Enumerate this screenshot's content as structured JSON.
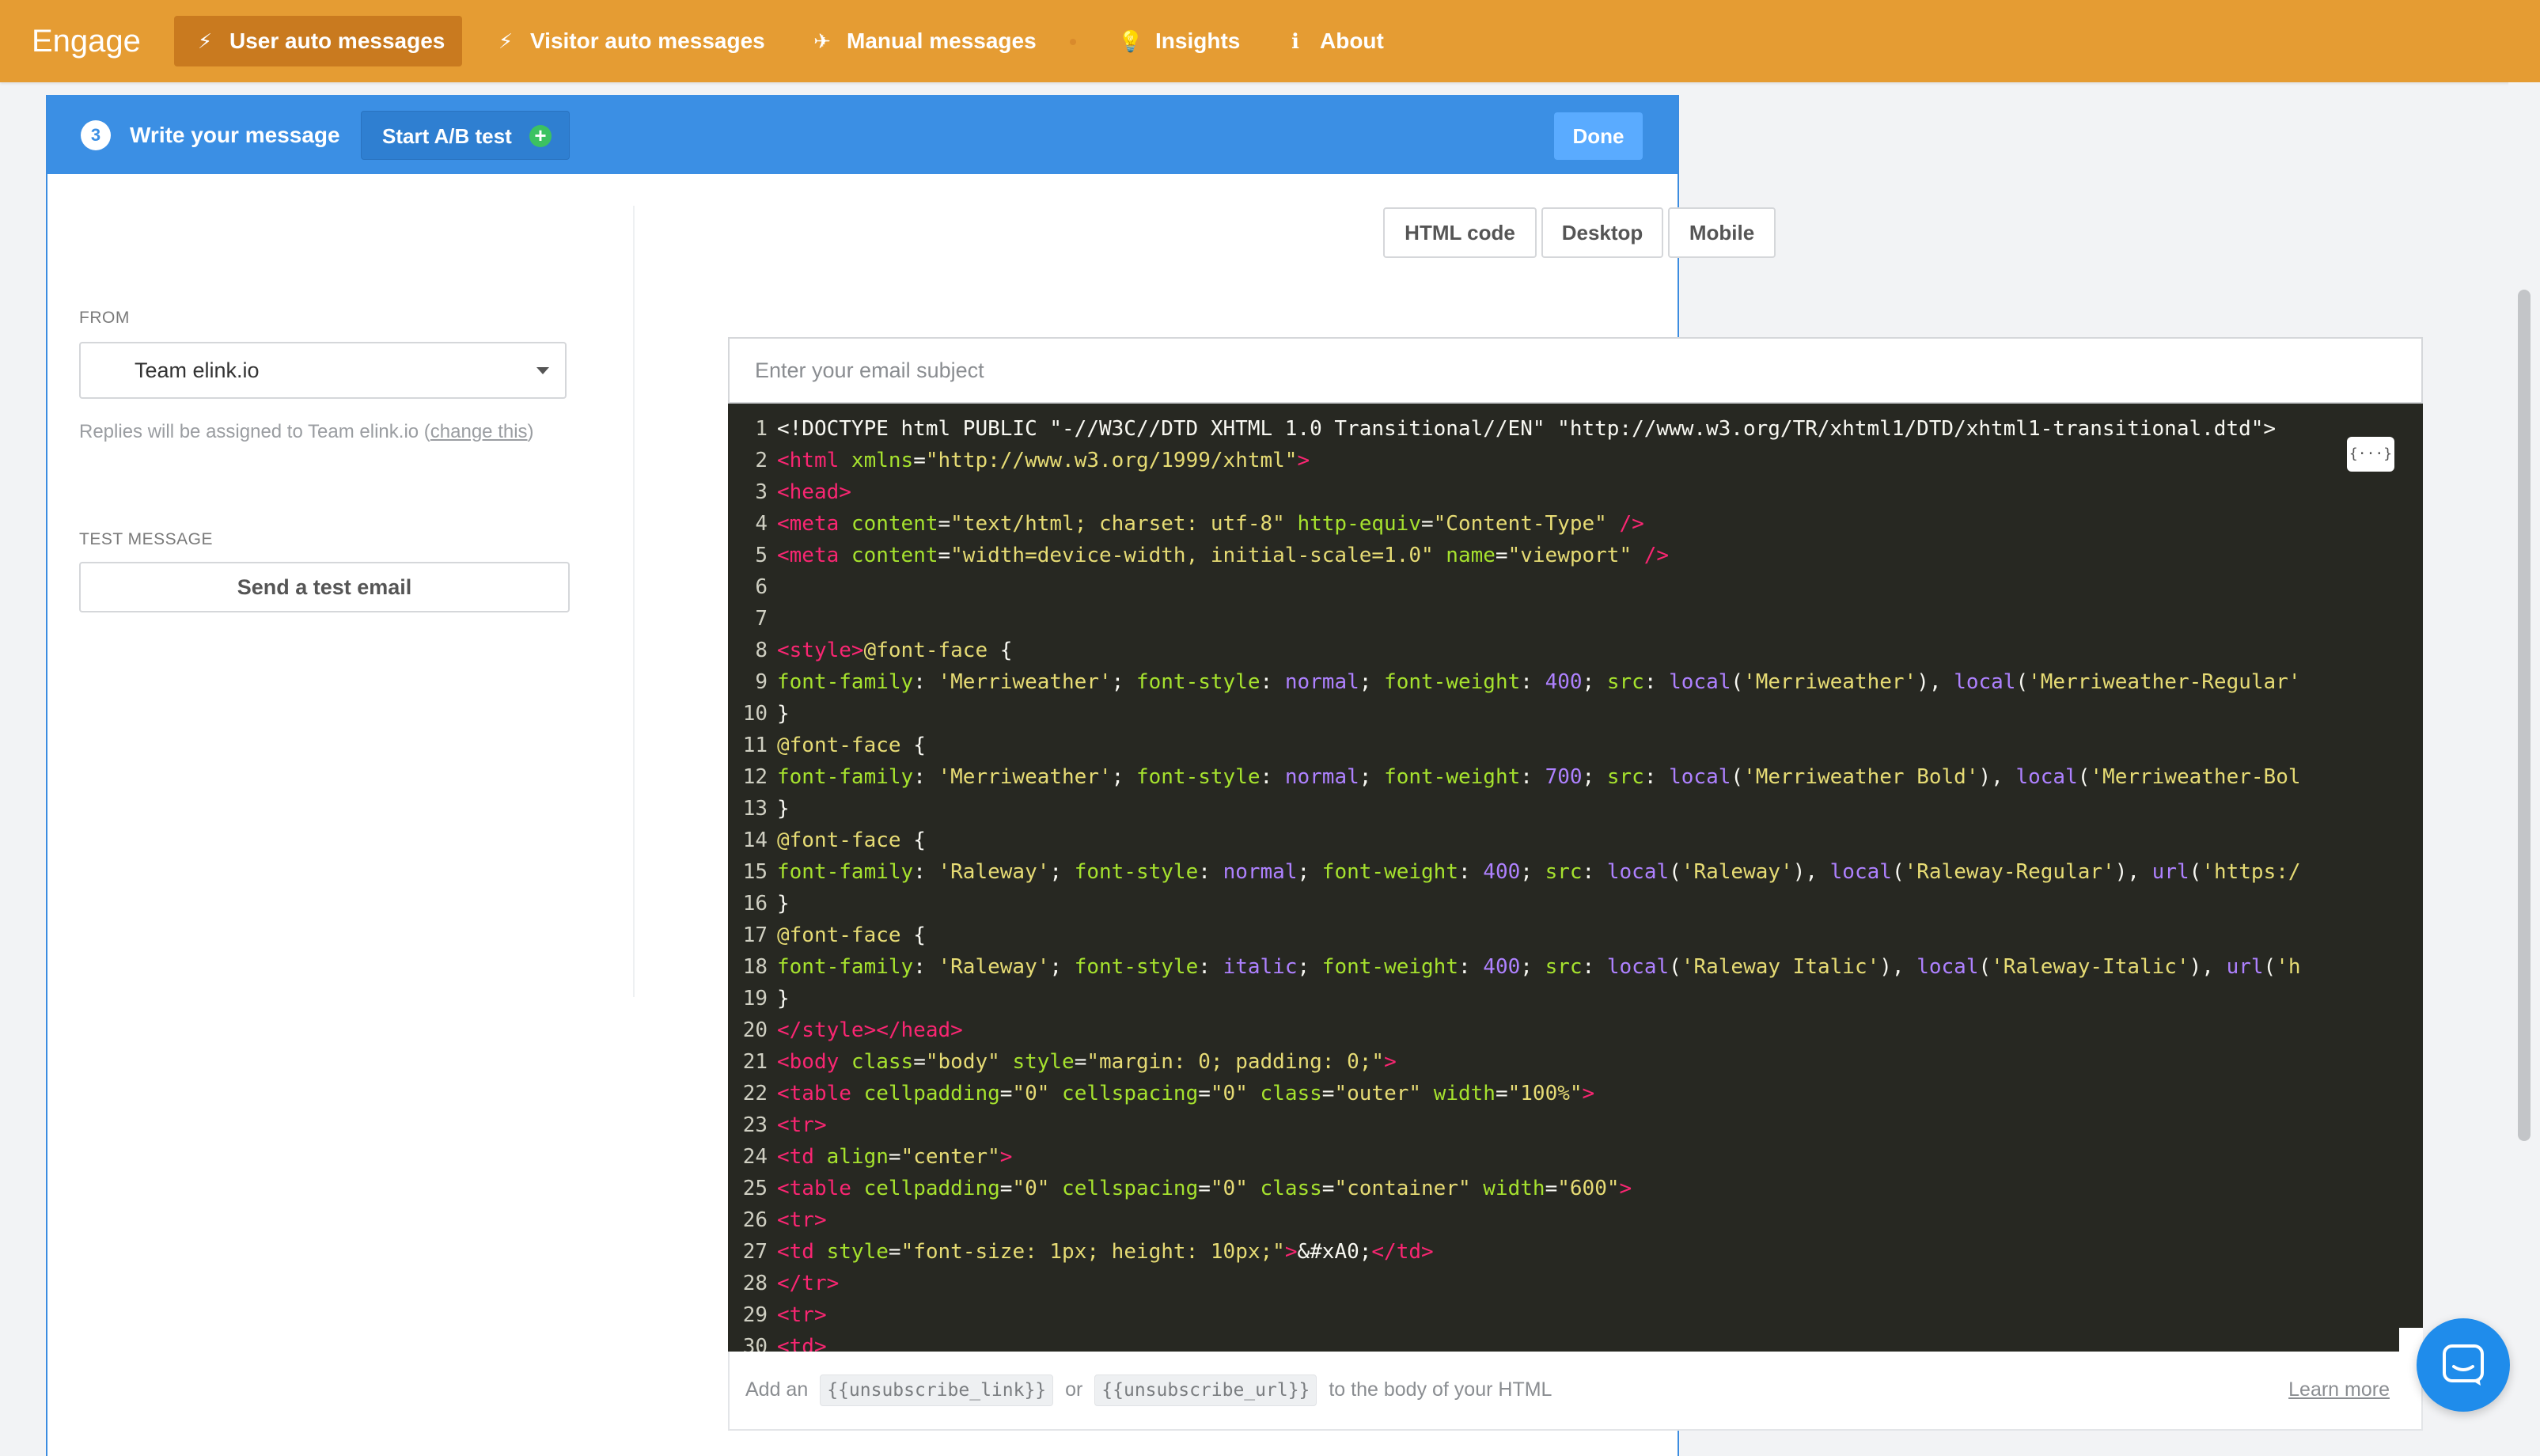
{
  "nav": {
    "brand": "Engage",
    "items": [
      {
        "label": "User auto messages",
        "icon": "bolt-icon",
        "glyph": "⚡",
        "active": true
      },
      {
        "label": "Visitor auto messages",
        "icon": "bolt-icon",
        "glyph": "⚡",
        "active": false
      },
      {
        "label": "Manual messages",
        "icon": "paper-plane-icon",
        "glyph": "✈",
        "active": false
      },
      {
        "label": "Insights",
        "icon": "lightbulb-icon",
        "glyph": "💡",
        "active": false
      },
      {
        "label": "About",
        "icon": "info-icon",
        "glyph": "ℹ",
        "active": false
      }
    ]
  },
  "header": {
    "step_number": "3",
    "title": "Write your message",
    "ab_button": "Start A/B test",
    "done_button": "Done"
  },
  "left": {
    "from_label": "FROM",
    "from_value": "Team elink.io",
    "replies_note_prefix": "Replies will be assigned to Team elink.io (",
    "replies_note_link": "change this",
    "replies_note_suffix": ")",
    "test_label": "TEST MESSAGE",
    "test_button": "Send a test email"
  },
  "view_tabs": [
    "HTML code",
    "Desktop",
    "Mobile"
  ],
  "subject": {
    "placeholder": "Enter your email subject",
    "value": ""
  },
  "code_lines": [
    [
      [
        "plain",
        "<!DOCTYPE html PUBLIC \"-//W3C//DTD XHTML 1.0 Transitional//EN\" \"http://www.w3.org/TR/xhtml1/DTD/xhtml1-transitional.dtd\">"
      ]
    ],
    [
      [
        "tag",
        "<html "
      ],
      [
        "attr",
        "xmlns"
      ],
      [
        "plain",
        "="
      ],
      [
        "str",
        "\"http://www.w3.org/1999/xhtml\""
      ],
      [
        "tag",
        ">"
      ]
    ],
    [
      [
        "tag",
        "<head>"
      ]
    ],
    [
      [
        "tag",
        "<meta "
      ],
      [
        "attr",
        "content"
      ],
      [
        "plain",
        "="
      ],
      [
        "str",
        "\"text/html; charset: utf-8\""
      ],
      [
        "plain",
        " "
      ],
      [
        "attr",
        "http-equiv"
      ],
      [
        "plain",
        "="
      ],
      [
        "str",
        "\"Content-Type\""
      ],
      [
        "plain",
        " "
      ],
      [
        "tag",
        "/>"
      ]
    ],
    [
      [
        "tag",
        "<meta "
      ],
      [
        "attr",
        "content"
      ],
      [
        "plain",
        "="
      ],
      [
        "str",
        "\"width=device-width, initial-scale=1.0\""
      ],
      [
        "plain",
        " "
      ],
      [
        "attr",
        "name"
      ],
      [
        "plain",
        "="
      ],
      [
        "str",
        "\"viewport\""
      ],
      [
        "plain",
        " "
      ],
      [
        "tag",
        "/>"
      ]
    ],
    [],
    [],
    [
      [
        "tag",
        "<style>"
      ],
      [
        "str",
        "@font-face"
      ],
      [
        "plain",
        " {"
      ]
    ],
    [
      [
        "prop",
        "font-family"
      ],
      [
        "plain",
        ": "
      ],
      [
        "str",
        "'Merriweather'"
      ],
      [
        "plain",
        "; "
      ],
      [
        "prop",
        "font-style"
      ],
      [
        "plain",
        ": "
      ],
      [
        "kw",
        "normal"
      ],
      [
        "plain",
        "; "
      ],
      [
        "prop",
        "font-weight"
      ],
      [
        "plain",
        ": "
      ],
      [
        "num",
        "400"
      ],
      [
        "plain",
        "; "
      ],
      [
        "prop",
        "src"
      ],
      [
        "plain",
        ": "
      ],
      [
        "kw",
        "local"
      ],
      [
        "plain",
        "("
      ],
      [
        "str",
        "'Merriweather'"
      ],
      [
        "plain",
        "), "
      ],
      [
        "kw",
        "local"
      ],
      [
        "plain",
        "("
      ],
      [
        "str",
        "'Merriweather-Regular'"
      ]
    ],
    [
      [
        "plain",
        "}"
      ]
    ],
    [
      [
        "str",
        "@font-face"
      ],
      [
        "plain",
        " {"
      ]
    ],
    [
      [
        "prop",
        "font-family"
      ],
      [
        "plain",
        ": "
      ],
      [
        "str",
        "'Merriweather'"
      ],
      [
        "plain",
        "; "
      ],
      [
        "prop",
        "font-style"
      ],
      [
        "plain",
        ": "
      ],
      [
        "kw",
        "normal"
      ],
      [
        "plain",
        "; "
      ],
      [
        "prop",
        "font-weight"
      ],
      [
        "plain",
        ": "
      ],
      [
        "num",
        "700"
      ],
      [
        "plain",
        "; "
      ],
      [
        "prop",
        "src"
      ],
      [
        "plain",
        ": "
      ],
      [
        "kw",
        "local"
      ],
      [
        "plain",
        "("
      ],
      [
        "str",
        "'Merriweather Bold'"
      ],
      [
        "plain",
        "), "
      ],
      [
        "kw",
        "local"
      ],
      [
        "plain",
        "("
      ],
      [
        "str",
        "'Merriweather-Bol"
      ]
    ],
    [
      [
        "plain",
        "}"
      ]
    ],
    [
      [
        "str",
        "@font-face"
      ],
      [
        "plain",
        " {"
      ]
    ],
    [
      [
        "prop",
        "font-family"
      ],
      [
        "plain",
        ": "
      ],
      [
        "str",
        "'Raleway'"
      ],
      [
        "plain",
        "; "
      ],
      [
        "prop",
        "font-style"
      ],
      [
        "plain",
        ": "
      ],
      [
        "kw",
        "normal"
      ],
      [
        "plain",
        "; "
      ],
      [
        "prop",
        "font-weight"
      ],
      [
        "plain",
        ": "
      ],
      [
        "num",
        "400"
      ],
      [
        "plain",
        "; "
      ],
      [
        "prop",
        "src"
      ],
      [
        "plain",
        ": "
      ],
      [
        "kw",
        "local"
      ],
      [
        "plain",
        "("
      ],
      [
        "str",
        "'Raleway'"
      ],
      [
        "plain",
        "), "
      ],
      [
        "kw",
        "local"
      ],
      [
        "plain",
        "("
      ],
      [
        "str",
        "'Raleway-Regular'"
      ],
      [
        "plain",
        "), "
      ],
      [
        "kw",
        "url"
      ],
      [
        "plain",
        "("
      ],
      [
        "str",
        "'https:/"
      ]
    ],
    [
      [
        "plain",
        "}"
      ]
    ],
    [
      [
        "str",
        "@font-face"
      ],
      [
        "plain",
        " {"
      ]
    ],
    [
      [
        "prop",
        "font-family"
      ],
      [
        "plain",
        ": "
      ],
      [
        "str",
        "'Raleway'"
      ],
      [
        "plain",
        "; "
      ],
      [
        "prop",
        "font-style"
      ],
      [
        "plain",
        ": "
      ],
      [
        "kw",
        "italic"
      ],
      [
        "plain",
        "; "
      ],
      [
        "prop",
        "font-weight"
      ],
      [
        "plain",
        ": "
      ],
      [
        "num",
        "400"
      ],
      [
        "plain",
        "; "
      ],
      [
        "prop",
        "src"
      ],
      [
        "plain",
        ": "
      ],
      [
        "kw",
        "local"
      ],
      [
        "plain",
        "("
      ],
      [
        "str",
        "'Raleway Italic'"
      ],
      [
        "plain",
        "), "
      ],
      [
        "kw",
        "local"
      ],
      [
        "plain",
        "("
      ],
      [
        "str",
        "'Raleway-Italic'"
      ],
      [
        "plain",
        "), "
      ],
      [
        "kw",
        "url"
      ],
      [
        "plain",
        "("
      ],
      [
        "str",
        "'h"
      ]
    ],
    [
      [
        "plain",
        "}"
      ]
    ],
    [
      [
        "tag",
        "</style></head>"
      ]
    ],
    [
      [
        "tag",
        "<body "
      ],
      [
        "attr",
        "class"
      ],
      [
        "plain",
        "="
      ],
      [
        "str",
        "\"body\""
      ],
      [
        "plain",
        " "
      ],
      [
        "attr",
        "style"
      ],
      [
        "plain",
        "="
      ],
      [
        "str",
        "\"margin: 0; padding: 0;\""
      ],
      [
        "tag",
        ">"
      ]
    ],
    [
      [
        "tag",
        "<table "
      ],
      [
        "attr",
        "cellpadding"
      ],
      [
        "plain",
        "="
      ],
      [
        "str",
        "\"0\""
      ],
      [
        "plain",
        " "
      ],
      [
        "attr",
        "cellspacing"
      ],
      [
        "plain",
        "="
      ],
      [
        "str",
        "\"0\""
      ],
      [
        "plain",
        " "
      ],
      [
        "attr",
        "class"
      ],
      [
        "plain",
        "="
      ],
      [
        "str",
        "\"outer\""
      ],
      [
        "plain",
        " "
      ],
      [
        "attr",
        "width"
      ],
      [
        "plain",
        "="
      ],
      [
        "str",
        "\"100%\""
      ],
      [
        "tag",
        ">"
      ]
    ],
    [
      [
        "tag",
        "<tr>"
      ]
    ],
    [
      [
        "tag",
        "<td "
      ],
      [
        "attr",
        "align"
      ],
      [
        "plain",
        "="
      ],
      [
        "str",
        "\"center\""
      ],
      [
        "tag",
        ">"
      ]
    ],
    [
      [
        "tag",
        "<table "
      ],
      [
        "attr",
        "cellpadding"
      ],
      [
        "plain",
        "="
      ],
      [
        "str",
        "\"0\""
      ],
      [
        "plain",
        " "
      ],
      [
        "attr",
        "cellspacing"
      ],
      [
        "plain",
        "="
      ],
      [
        "str",
        "\"0\""
      ],
      [
        "plain",
        " "
      ],
      [
        "attr",
        "class"
      ],
      [
        "plain",
        "="
      ],
      [
        "str",
        "\"container\""
      ],
      [
        "plain",
        " "
      ],
      [
        "attr",
        "width"
      ],
      [
        "plain",
        "="
      ],
      [
        "str",
        "\"600\""
      ],
      [
        "tag",
        ">"
      ]
    ],
    [
      [
        "tag",
        "<tr>"
      ]
    ],
    [
      [
        "tag",
        "<td "
      ],
      [
        "attr",
        "style"
      ],
      [
        "plain",
        "="
      ],
      [
        "str",
        "\"font-size: 1px; height: 10px;\""
      ],
      [
        "tag",
        ">"
      ],
      [
        "plain",
        "&#xA0;"
      ],
      [
        "tag",
        "</td>"
      ]
    ],
    [
      [
        "tag",
        "</tr>"
      ]
    ],
    [
      [
        "tag",
        "<tr>"
      ]
    ],
    [
      [
        "tag",
        "<td>"
      ]
    ]
  ],
  "code_chip": "{···}",
  "footer": {
    "prefix": "Add an",
    "var1": "{{unsubscribe_link}}",
    "middle": "or",
    "var2": "{{unsubscribe_url}}",
    "suffix": "to the body of your HTML",
    "learn_more": "Learn more"
  },
  "colors": {
    "nav_bg": "#e59c33",
    "header_bg": "#3b8fe4",
    "editor_bg": "#272822",
    "chat_bg": "#1f8ceb"
  }
}
